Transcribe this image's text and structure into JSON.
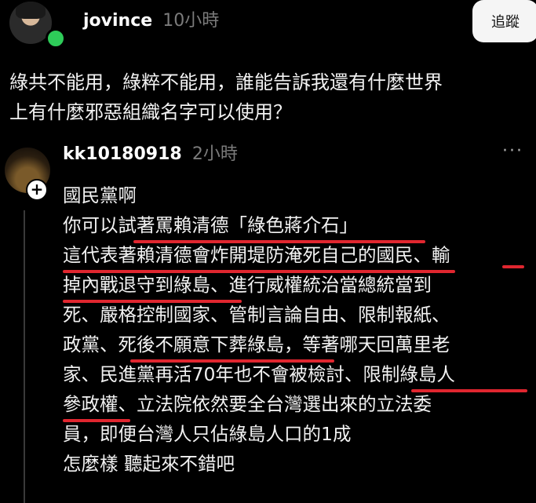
{
  "post": {
    "username": "jovince",
    "time": "10小時",
    "follow_label": "追蹤",
    "lines": [
      "綠共不能用，綠粹不能用，誰能告訴我還有什麼世界",
      "上有什麼邪惡組織名字可以使用？"
    ]
  },
  "reply": {
    "username": "kk10180918",
    "time": "2小時",
    "menu_icon": "more-dots-icon",
    "lines": [
      "國民黨啊",
      "你可以試著罵賴清德「綠色蔣介石」",
      "這代表著賴清德會炸開堤防淹死自己的國民、輸",
      "掉內戰退守到綠島、進行威權統治當總統當到",
      "死、嚴格控制國家、管制言論自由、限制報紙、",
      "政黨、死後不願意下葬綠島，等著哪天回萬里老",
      "家、民進黨再活70年也不會被檢討、限制綠島人",
      "參政權、立法院依然要全台灣選出來的立法委",
      "員，即便台灣人只佔綠島人口的1成",
      "怎麼樣 聽起來不錯吧"
    ]
  },
  "colors": {
    "background": "#000000",
    "online": "#2ecc59",
    "highlight": "#e0262f"
  }
}
